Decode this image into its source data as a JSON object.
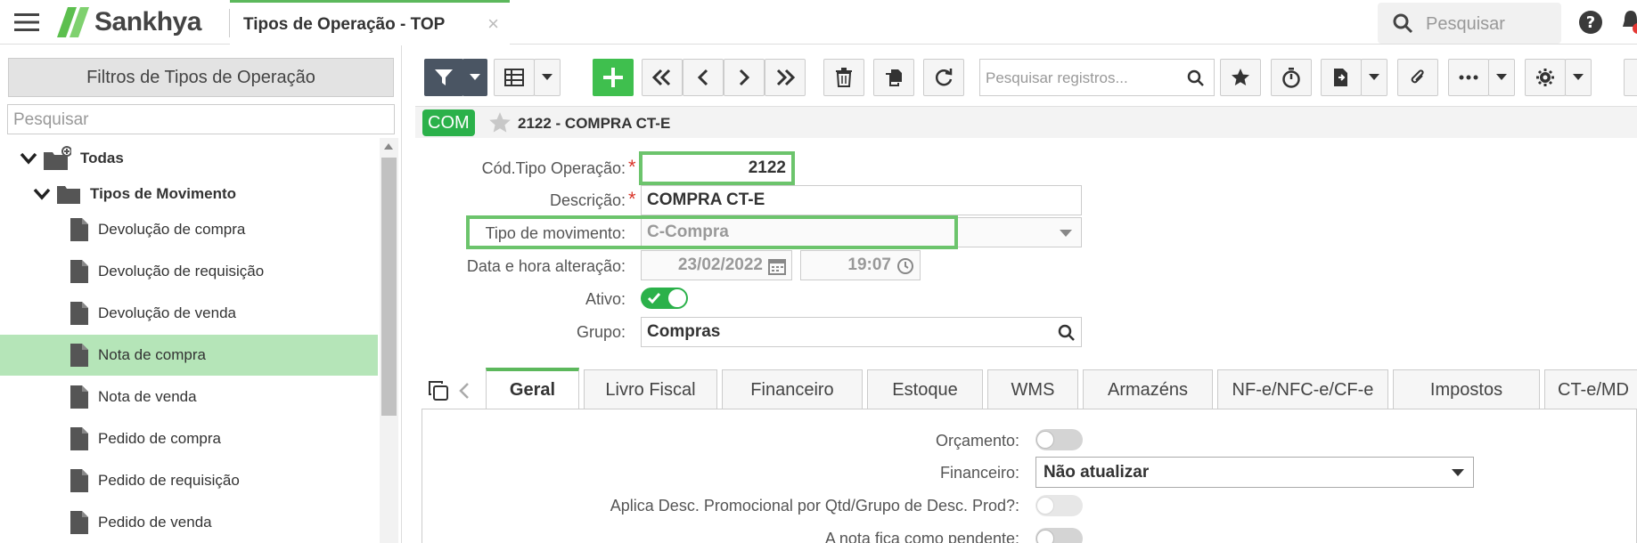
{
  "header": {
    "app_name": "Sankhya",
    "tab_title": "Tipos de Operação - TOP",
    "tab_close": "×",
    "search_placeholder": "Pesquisar"
  },
  "left_panel": {
    "title": "Filtros de Tipos de Operação",
    "search_placeholder": "Pesquisar",
    "tree": {
      "root": "Todas",
      "group": "Tipos de Movimento",
      "items": [
        "Devolução de compra",
        "Devolução de requisição",
        "Devolução de venda",
        "Nota de compra",
        "Nota de venda",
        "Pedido de compra",
        "Pedido de requisição",
        "Pedido de venda"
      ],
      "selected_index": 3
    }
  },
  "toolbar": {
    "search_placeholder": "Pesquisar registros..."
  },
  "record": {
    "badge": "COM",
    "title": "2122 - COMPRA CT-E"
  },
  "form": {
    "cod_label": "Cód.Tipo Operação:",
    "cod_value": "2122",
    "descricao_label": "Descrição:",
    "descricao_value": "COMPRA CT-E",
    "tipo_label": "Tipo de movimento:",
    "tipo_value": "C-Compra",
    "data_label": "Data e hora alteração:",
    "data_value": "23/02/2022",
    "hora_value": "19:07",
    "ativo_label": "Ativo:",
    "ativo_on": true,
    "grupo_label": "Grupo:",
    "grupo_value": "Compras",
    "required_mark": "*"
  },
  "tabs": [
    "Geral",
    "Livro Fiscal",
    "Financeiro",
    "Estoque",
    "WMS",
    "Armazéns",
    "NF-e/NFC-e/CF-e",
    "Impostos",
    "CT-e/MD"
  ],
  "active_tab": "Geral",
  "geral": {
    "orcamento_label": "Orçamento:",
    "financeiro_label": "Financeiro:",
    "financeiro_value": "Não atualizar",
    "aplica_desc_label": "Aplica Desc. Promocional por Qtd/Grupo de Desc. Prod?:",
    "nota_pendente_label": "A nota fica como pendente:"
  },
  "colors": {
    "accent_green": "#2bb14a",
    "highlight_green": "#6cc46c",
    "selected_row": "#b5e5b8",
    "toolbar_dark": "#4a5563"
  }
}
